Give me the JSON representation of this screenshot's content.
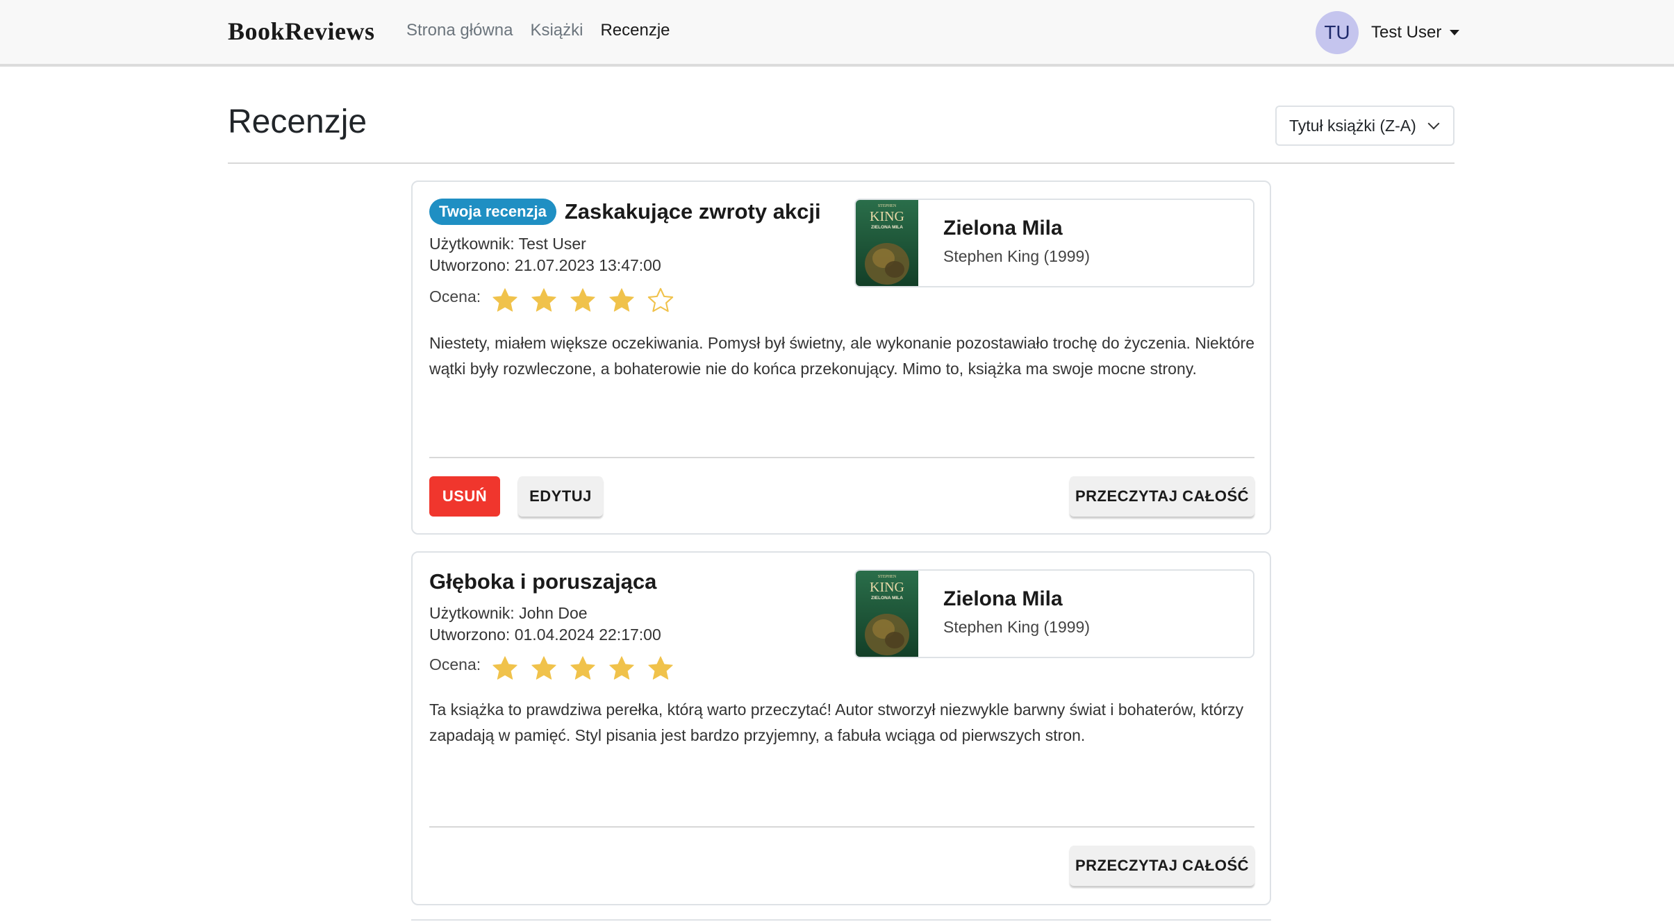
{
  "navbar": {
    "brand": "BookReviews",
    "links": [
      {
        "label": "Strona główna"
      },
      {
        "label": "Książki"
      },
      {
        "label": "Recenzje"
      }
    ],
    "user": {
      "initials": "TU",
      "name": "Test User"
    }
  },
  "page": {
    "title": "Recenzje",
    "sort": {
      "selected": "Tytuł książki (Z-A)"
    }
  },
  "reviews": [
    {
      "badge": "Twoja recenzja",
      "title": "Zaskakujące zwroty akcji",
      "user": "Użytkownik: Test User",
      "created": "Utworzono: 21.07.2023 13:47:00",
      "rating_label": "Ocena:",
      "rating": 4,
      "rating_max": 5,
      "body": "Niestety, miałem większe oczekiwania. Pomysł był świetny, ale wykonanie pozostawiało trochę do życzenia. Niektóre wątki były rozwleczone, a bohaterowie nie do końca przekonujący. Mimo to, książka ma swoje mocne strony.",
      "book": {
        "title": "Zielona Mila",
        "author_year": "Stephen King (1999)",
        "cover_top": "STEPHEN",
        "cover_main": "KING",
        "cover_sub": "ZIELONA MILA"
      },
      "buttons": {
        "delete": "USUŃ",
        "edit": "EDYTUJ",
        "read": "PRZECZYTAJ CAŁOŚĆ"
      }
    },
    {
      "title": "Głęboka i poruszająca",
      "user": "Użytkownik: John Doe",
      "created": "Utworzono: 01.04.2024 22:17:00",
      "rating_label": "Ocena:",
      "rating": 5,
      "rating_max": 5,
      "body": "Ta książka to prawdziwa perełka, którą warto przeczytać! Autor stworzył niezwykle barwny świat i bohaterów, którzy zapadają w pamięć. Styl pisania jest bardzo przyjemny, a fabuła wciąga od pierwszych stron.",
      "book": {
        "title": "Zielona Mila",
        "author_year": "Stephen King (1999)",
        "cover_top": "STEPHEN",
        "cover_main": "KING",
        "cover_sub": "ZIELONA MILA"
      },
      "buttons": {
        "read": "PRZECZYTAJ CAŁOŚĆ"
      }
    }
  ],
  "colors": {
    "star": "#f0c24b",
    "badge": "#1f8fc3",
    "delete": "#f0362d",
    "cover": "#1d5a3a"
  }
}
